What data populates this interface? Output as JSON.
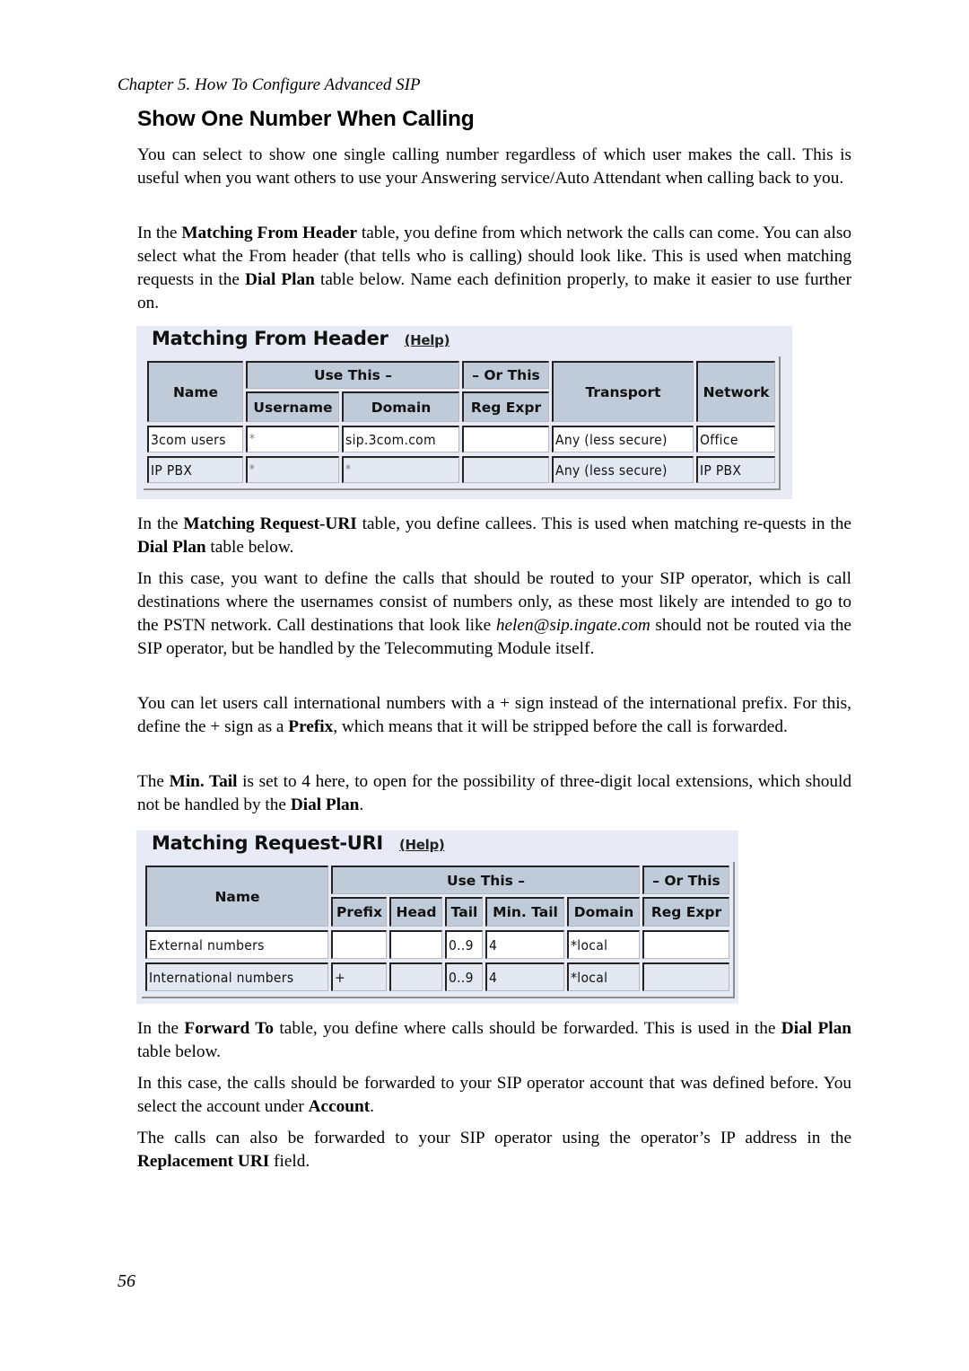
{
  "page": {
    "running_head": "Chapter 5. How To Configure Advanced SIP",
    "section_title": "Show One Number When Calling",
    "page_number": "56"
  },
  "paragraphs": {
    "p1": "You can select to show one single calling number regardless of which user makes the call. This is useful when you want others to use your Answering service/Auto Attendant when calling back to you.",
    "p2": [
      {
        "t": "In the "
      },
      {
        "b": "Matching From Header"
      },
      {
        "t": " table, you define from which network the calls can come. You can also select what the From header (that tells who is calling) should look like. This is used when matching requests in the "
      },
      {
        "b": "Dial Plan"
      },
      {
        "t": " table below. Name each definition properly, to make it easier to use further on."
      }
    ],
    "p3": [
      {
        "t": "In the "
      },
      {
        "b": "Matching Request-URI"
      },
      {
        "t": " table, you define callees. This is used when matching re-quests in the "
      },
      {
        "b": "Dial Plan"
      },
      {
        "t": " table below."
      }
    ],
    "p4": [
      {
        "t": "In this case, you want to define the calls that should be routed to your SIP operator, which is call destinations where the usernames consist of numbers only, as these most likely are intended to go to the PSTN network. Call destinations that look like "
      },
      {
        "i": "helen@sip.ingate.com"
      },
      {
        "t": " should not be routed via the SIP operator, but be handled by the Telecommuting Module itself."
      }
    ],
    "p5": [
      {
        "t": "You can let users call international numbers with a + sign instead of the international prefix. For this, define the + sign as a "
      },
      {
        "b": "Prefix"
      },
      {
        "t": ", which means that it will be stripped before the call is forwarded."
      }
    ],
    "p6": [
      {
        "t": "The "
      },
      {
        "b": "Min. Tail"
      },
      {
        "t": " is set to 4 here, to open for the possibility of three-digit local extensions, which should not be handled by the "
      },
      {
        "b": "Dial Plan"
      },
      {
        "t": "."
      }
    ],
    "p7": [
      {
        "t": "In the "
      },
      {
        "b": "Forward To"
      },
      {
        "t": " table, you define where calls should be forwarded. This is used in the "
      },
      {
        "b": "Dial Plan"
      },
      {
        "t": " table below."
      }
    ],
    "p8": [
      {
        "t": "In this case, the calls should be forwarded to your SIP operator account that was defined before. You select the account under "
      },
      {
        "b": "Account"
      },
      {
        "t": "."
      }
    ],
    "p9": [
      {
        "t": "The calls can also be forwarded to your SIP operator using the operator’s IP address in the "
      },
      {
        "b": "Replacement URI"
      },
      {
        "t": " field."
      }
    ]
  },
  "from_header_table": {
    "title": "Matching From Header",
    "help": "(Help)",
    "headers": {
      "name": "Name",
      "use_this": "Use This –",
      "or_this": "– Or This",
      "username": "Username",
      "domain": "Domain",
      "reg_expr": "Reg Expr",
      "transport": "Transport",
      "network": "Network"
    },
    "rows": [
      {
        "name": "3com users",
        "username": "*",
        "domain": "sip.3com.com",
        "reg_expr": "",
        "transport": "Any (less secure)",
        "network": "Office"
      },
      {
        "name": "IP PBX",
        "username": "*",
        "domain": "*",
        "reg_expr": "",
        "transport": "Any (less secure)",
        "network": "IP PBX"
      }
    ]
  },
  "request_uri_table": {
    "title": "Matching Request-URI",
    "help": "(Help)",
    "headers": {
      "name": "Name",
      "use_this": "Use This –",
      "or_this": "– Or This",
      "prefix": "Prefix",
      "head": "Head",
      "tail": "Tail",
      "min_tail": "Min. Tail",
      "domain": "Domain",
      "reg_expr": "Reg Expr"
    },
    "rows": [
      {
        "name": "External numbers",
        "prefix": "",
        "head": "",
        "tail": "0..9",
        "min_tail": "4",
        "domain": "*local",
        "reg_expr": ""
      },
      {
        "name": "International numbers",
        "prefix": "+",
        "head": "",
        "tail": "0..9",
        "min_tail": "4",
        "domain": "*local",
        "reg_expr": ""
      }
    ]
  }
}
